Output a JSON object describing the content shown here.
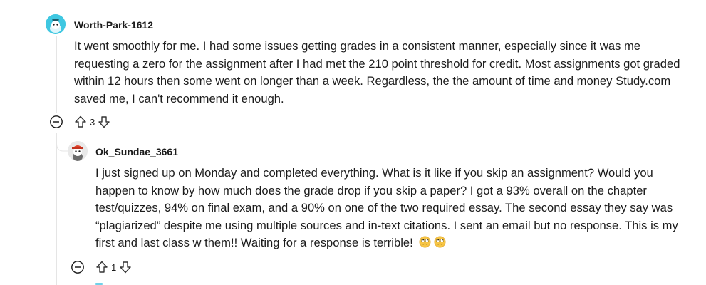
{
  "comments": [
    {
      "username": "Worth-Park-1612",
      "avatar": "snoo-avatar-teal",
      "body": "It went smoothly for me. I had some issues getting grades in a consistent manner, especially since it was me requesting a zero for the assignment after I had met the 210 point threshold for credit. Most assignments got graded within 12 hours then some went on longer than a week. Regardless, the the amount of time and money Study.com saved me, I can't recommend it enough.",
      "score": "3"
    },
    {
      "username": "Ok_Sundae_3661",
      "avatar": "snoo-avatar-red-cap",
      "body": "I just signed up on Monday and completed everything. What is it like if you skip an assignment? Would you happen to know by how much does the grade drop if you skip a paper? I got a 93% overall on the chapter test/quizzes, 94% on final exam, and a 90% on one of the two required essay. The second essay they say was “plagiarized” despite me using multiple sources and in-text citations. I sent an email but no response. This is my first and last class w them!! Waiting for a response is terrible!",
      "score": "1",
      "emojis": [
        "face-with-rolling-eyes-emoji",
        "face-with-rolling-eyes-emoji"
      ]
    }
  ],
  "colors": {
    "thread_line": "#e5e5e5",
    "text": "#1c1c1c",
    "icon": "#333333",
    "avatar_teal": "#3fc7e1",
    "emoji_yellow": "#f7c545"
  }
}
